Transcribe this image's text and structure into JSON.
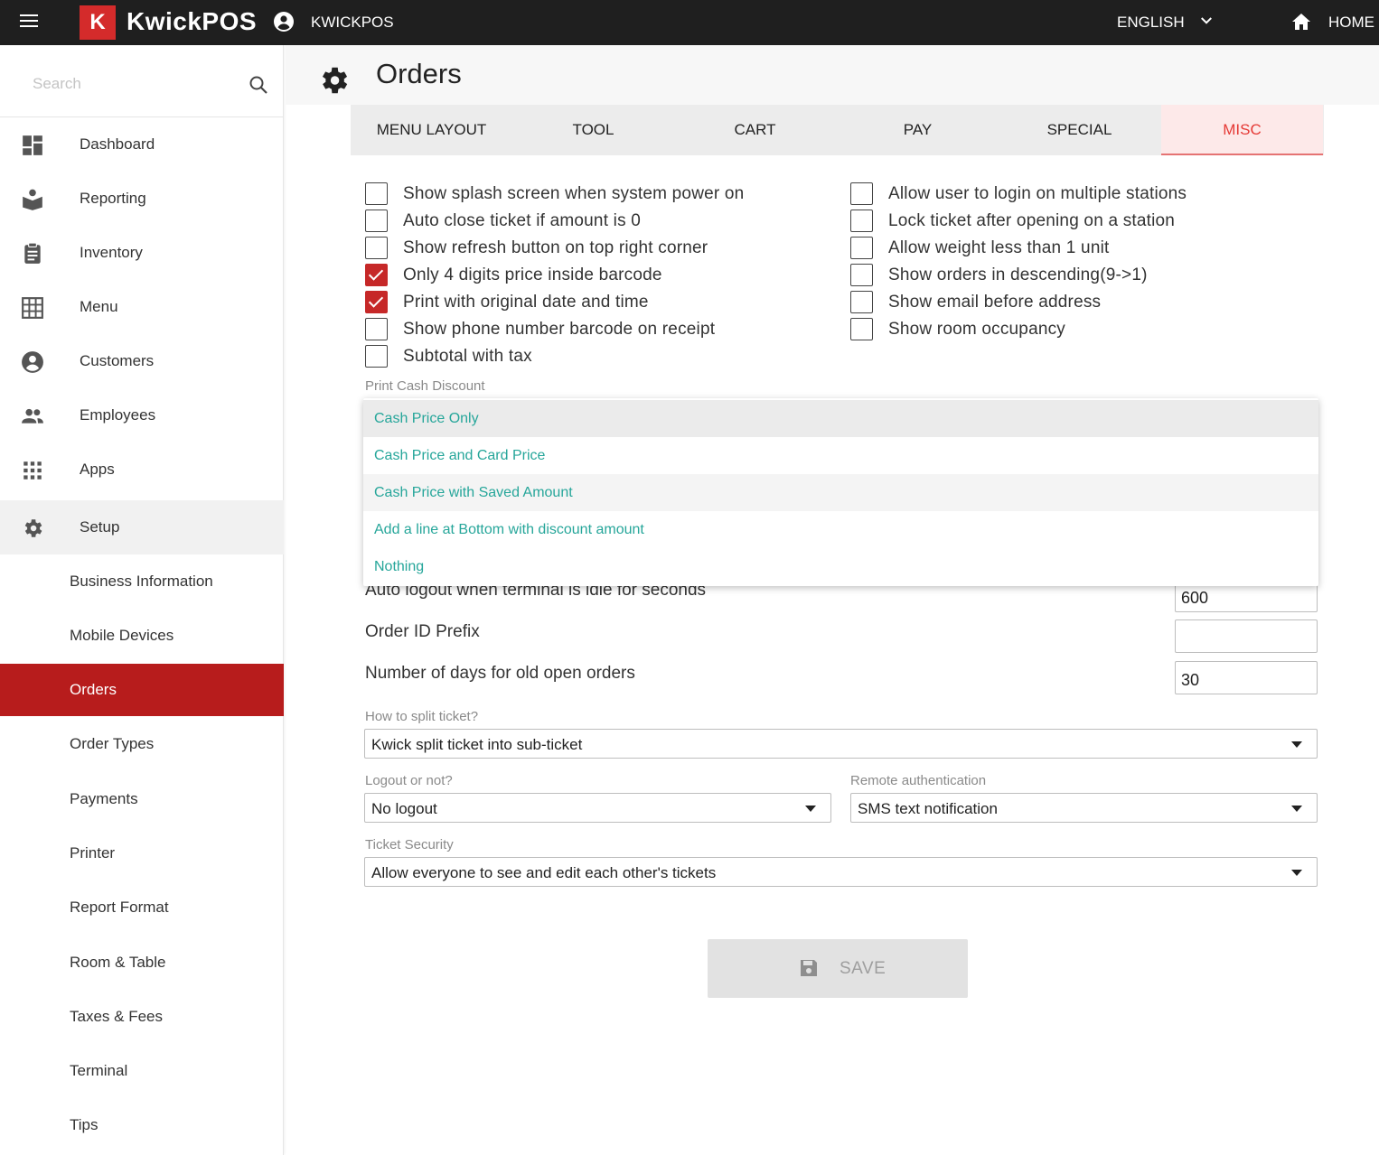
{
  "topbar": {
    "logo_letter": "K",
    "brand": "KwickPOS",
    "user": "KWICKPOS",
    "language": "ENGLISH",
    "home": "HOME"
  },
  "sidebar": {
    "search_placeholder": "Search",
    "items": [
      {
        "label": "Dashboard",
        "icon": "dashboard-icon"
      },
      {
        "label": "Reporting",
        "icon": "reporting-icon"
      },
      {
        "label": "Inventory",
        "icon": "inventory-icon"
      },
      {
        "label": "Menu",
        "icon": "menu-grid-icon"
      },
      {
        "label": "Customers",
        "icon": "customer-icon"
      },
      {
        "label": "Employees",
        "icon": "employees-icon"
      },
      {
        "label": "Apps",
        "icon": "apps-icon"
      },
      {
        "label": "Setup",
        "icon": "gear-icon"
      }
    ],
    "sub_items": [
      "Business Information",
      "Mobile Devices",
      "Orders",
      "Order Types",
      "Payments",
      "Printer",
      "Report Format",
      "Room & Table",
      "Taxes & Fees",
      "Terminal",
      "Tips"
    ],
    "selected_sub": "Orders"
  },
  "page": {
    "title": "Orders"
  },
  "tabs": [
    "MENU LAYOUT",
    "TOOL",
    "CART",
    "PAY",
    "SPECIAL",
    "MISC"
  ],
  "active_tab": "MISC",
  "checkboxes_left": [
    {
      "label": "Show splash screen when system power on",
      "checked": false
    },
    {
      "label": "Auto close ticket if amount is 0",
      "checked": false
    },
    {
      "label": "Show refresh button on top right corner",
      "checked": false
    },
    {
      "label": "Only 4 digits price inside barcode",
      "checked": true
    },
    {
      "label": "Print with original date and time",
      "checked": true
    },
    {
      "label": "Show phone number barcode on receipt",
      "checked": false
    },
    {
      "label": "Subtotal with tax",
      "checked": false
    }
  ],
  "checkboxes_right": [
    {
      "label": "Allow user to login on multiple stations",
      "checked": false
    },
    {
      "label": "Lock ticket after opening on a station",
      "checked": false
    },
    {
      "label": "Allow weight less than 1 unit",
      "checked": false
    },
    {
      "label": "Show orders in descending(9->1)",
      "checked": false
    },
    {
      "label": "Show email before address",
      "checked": false
    },
    {
      "label": "Show room occupancy",
      "checked": false
    }
  ],
  "print_cash_discount": {
    "caption": "Print Cash Discount",
    "options": [
      "Cash Price Only",
      "Cash Price and Card Price",
      "Cash Price with Saved Amount",
      "Add a line at Bottom with discount amount",
      "Nothing"
    ]
  },
  "fields": {
    "auto_logout_label": "Auto logout when terminal is idle for seconds",
    "auto_logout_value": "600",
    "order_prefix_label": "Order ID Prefix",
    "order_prefix_value": "",
    "old_orders_label": "Number of days for old open orders",
    "old_orders_value": "30"
  },
  "selects": {
    "split_caption": "How to split ticket?",
    "split_value": "Kwick split ticket into sub-ticket",
    "logout_caption": "Logout or not?",
    "logout_value": "No logout",
    "remote_caption": "Remote authentication",
    "remote_value": "SMS text notification",
    "security_caption": "Ticket Security",
    "security_value": "Allow everyone to see and edit each other's tickets"
  },
  "save": {
    "label": "SAVE"
  },
  "colors": {
    "brand_red": "#d42b2b",
    "selected_red": "#b71c1c",
    "active_tab_text": "#e53935",
    "option_teal": "#26a69a"
  }
}
